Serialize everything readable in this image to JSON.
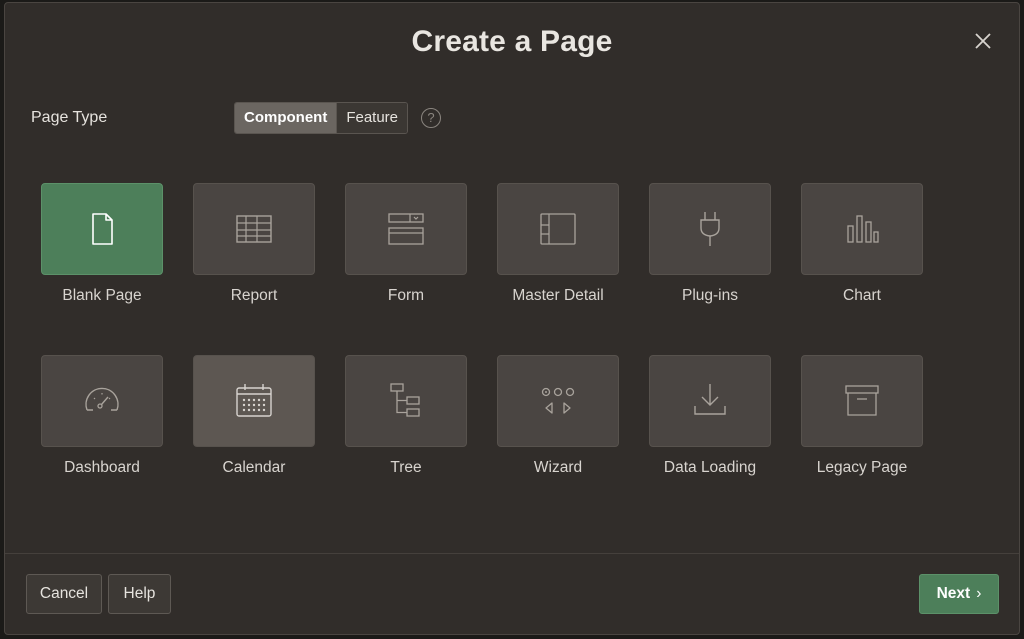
{
  "dialog": {
    "title": "Create a Page",
    "close_icon": "close-icon"
  },
  "page_type": {
    "label": "Page Type",
    "options": [
      "Component",
      "Feature"
    ],
    "selected": "Component",
    "help_icon": "?"
  },
  "tiles": [
    {
      "label": "Blank Page",
      "icon": "blank-page-icon",
      "selected": true
    },
    {
      "label": "Report",
      "icon": "report-icon"
    },
    {
      "label": "Form",
      "icon": "form-icon"
    },
    {
      "label": "Master Detail",
      "icon": "master-detail-icon"
    },
    {
      "label": "Plug-ins",
      "icon": "plug-icon"
    },
    {
      "label": "Chart",
      "icon": "chart-icon"
    },
    {
      "label": "Dashboard",
      "icon": "gauge-icon"
    },
    {
      "label": "Calendar",
      "icon": "calendar-icon",
      "hover": true
    },
    {
      "label": "Tree",
      "icon": "tree-icon"
    },
    {
      "label": "Wizard",
      "icon": "wizard-icon"
    },
    {
      "label": "Data Loading",
      "icon": "download-icon"
    },
    {
      "label": "Legacy Page",
      "icon": "archive-icon"
    }
  ],
  "footer": {
    "cancel_label": "Cancel",
    "help_label": "Help",
    "next_label": "Next",
    "next_chevron": "›"
  },
  "colors": {
    "dialog_bg": "#312d2a",
    "tile_bg": "#4a4542",
    "accent_green": "#4d7f5a"
  }
}
